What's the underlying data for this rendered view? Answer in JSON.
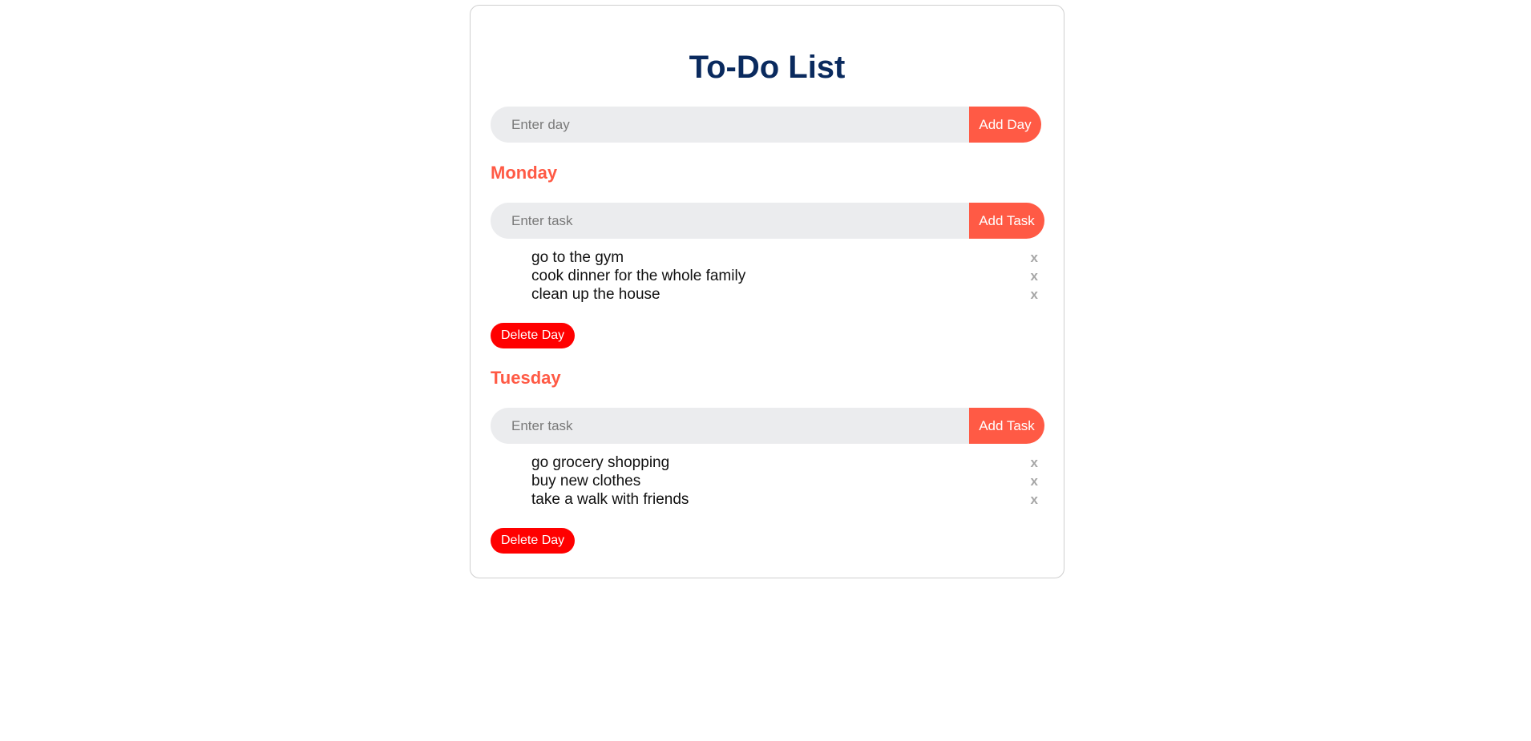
{
  "title": "To-Do List",
  "add_day": {
    "placeholder": "Enter day",
    "value": "",
    "button_label": "Add Day"
  },
  "days": [
    {
      "name": "Monday",
      "task_placeholder": "Enter task",
      "add_task_label": "Add Task",
      "tasks": [
        {
          "text": "go to the gym",
          "delete": "x"
        },
        {
          "text": "cook dinner for the whole family",
          "delete": "x"
        },
        {
          "text": "clean up the house",
          "delete": "x"
        }
      ],
      "delete_day_label": "Delete Day"
    },
    {
      "name": "Tuesday",
      "task_placeholder": "Enter task",
      "add_task_label": "Add Task",
      "tasks": [
        {
          "text": "go grocery shopping",
          "delete": "x"
        },
        {
          "text": "buy new clothes",
          "delete": "x"
        },
        {
          "text": "take a walk with friends",
          "delete": "x"
        }
      ],
      "delete_day_label": "Delete Day"
    }
  ],
  "colors": {
    "title": "#0a2a5e",
    "accent": "#ff5a45",
    "delete_day": "#ff0000",
    "input_bg": "#ebecee"
  }
}
